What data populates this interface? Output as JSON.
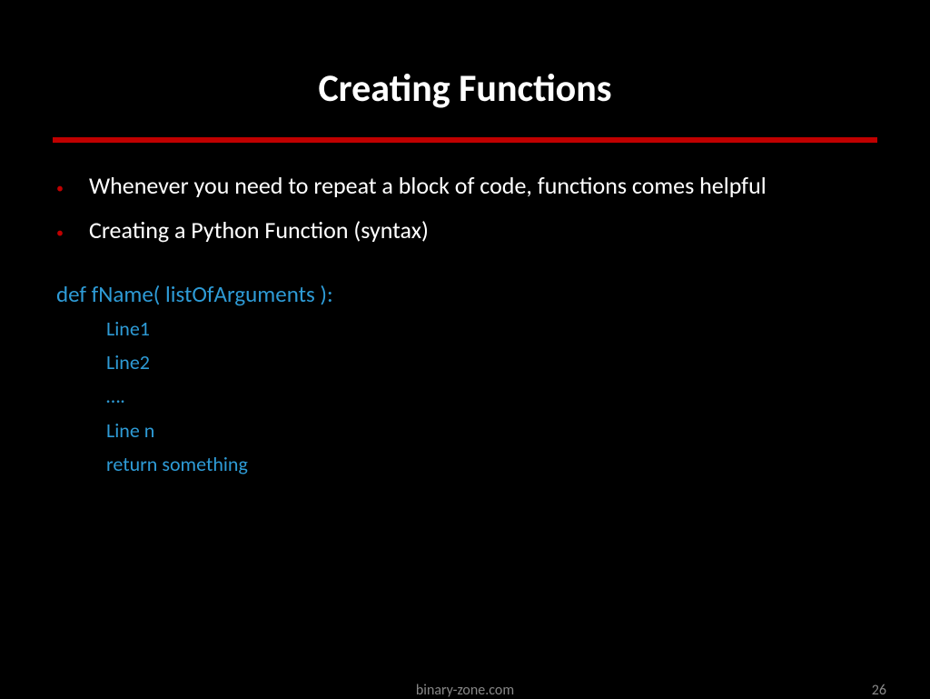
{
  "title": "Creating Functions",
  "bullets": [
    "Whenever you need to repeat a block of code, functions comes helpful",
    "Creating a Python Function (syntax)"
  ],
  "code": {
    "defline": "def fName( listOfArguments ):",
    "body": [
      "Line1",
      "Line2",
      "….",
      "Line n",
      "return something"
    ]
  },
  "footer": {
    "center": "binary-zone.com",
    "page": "26"
  }
}
